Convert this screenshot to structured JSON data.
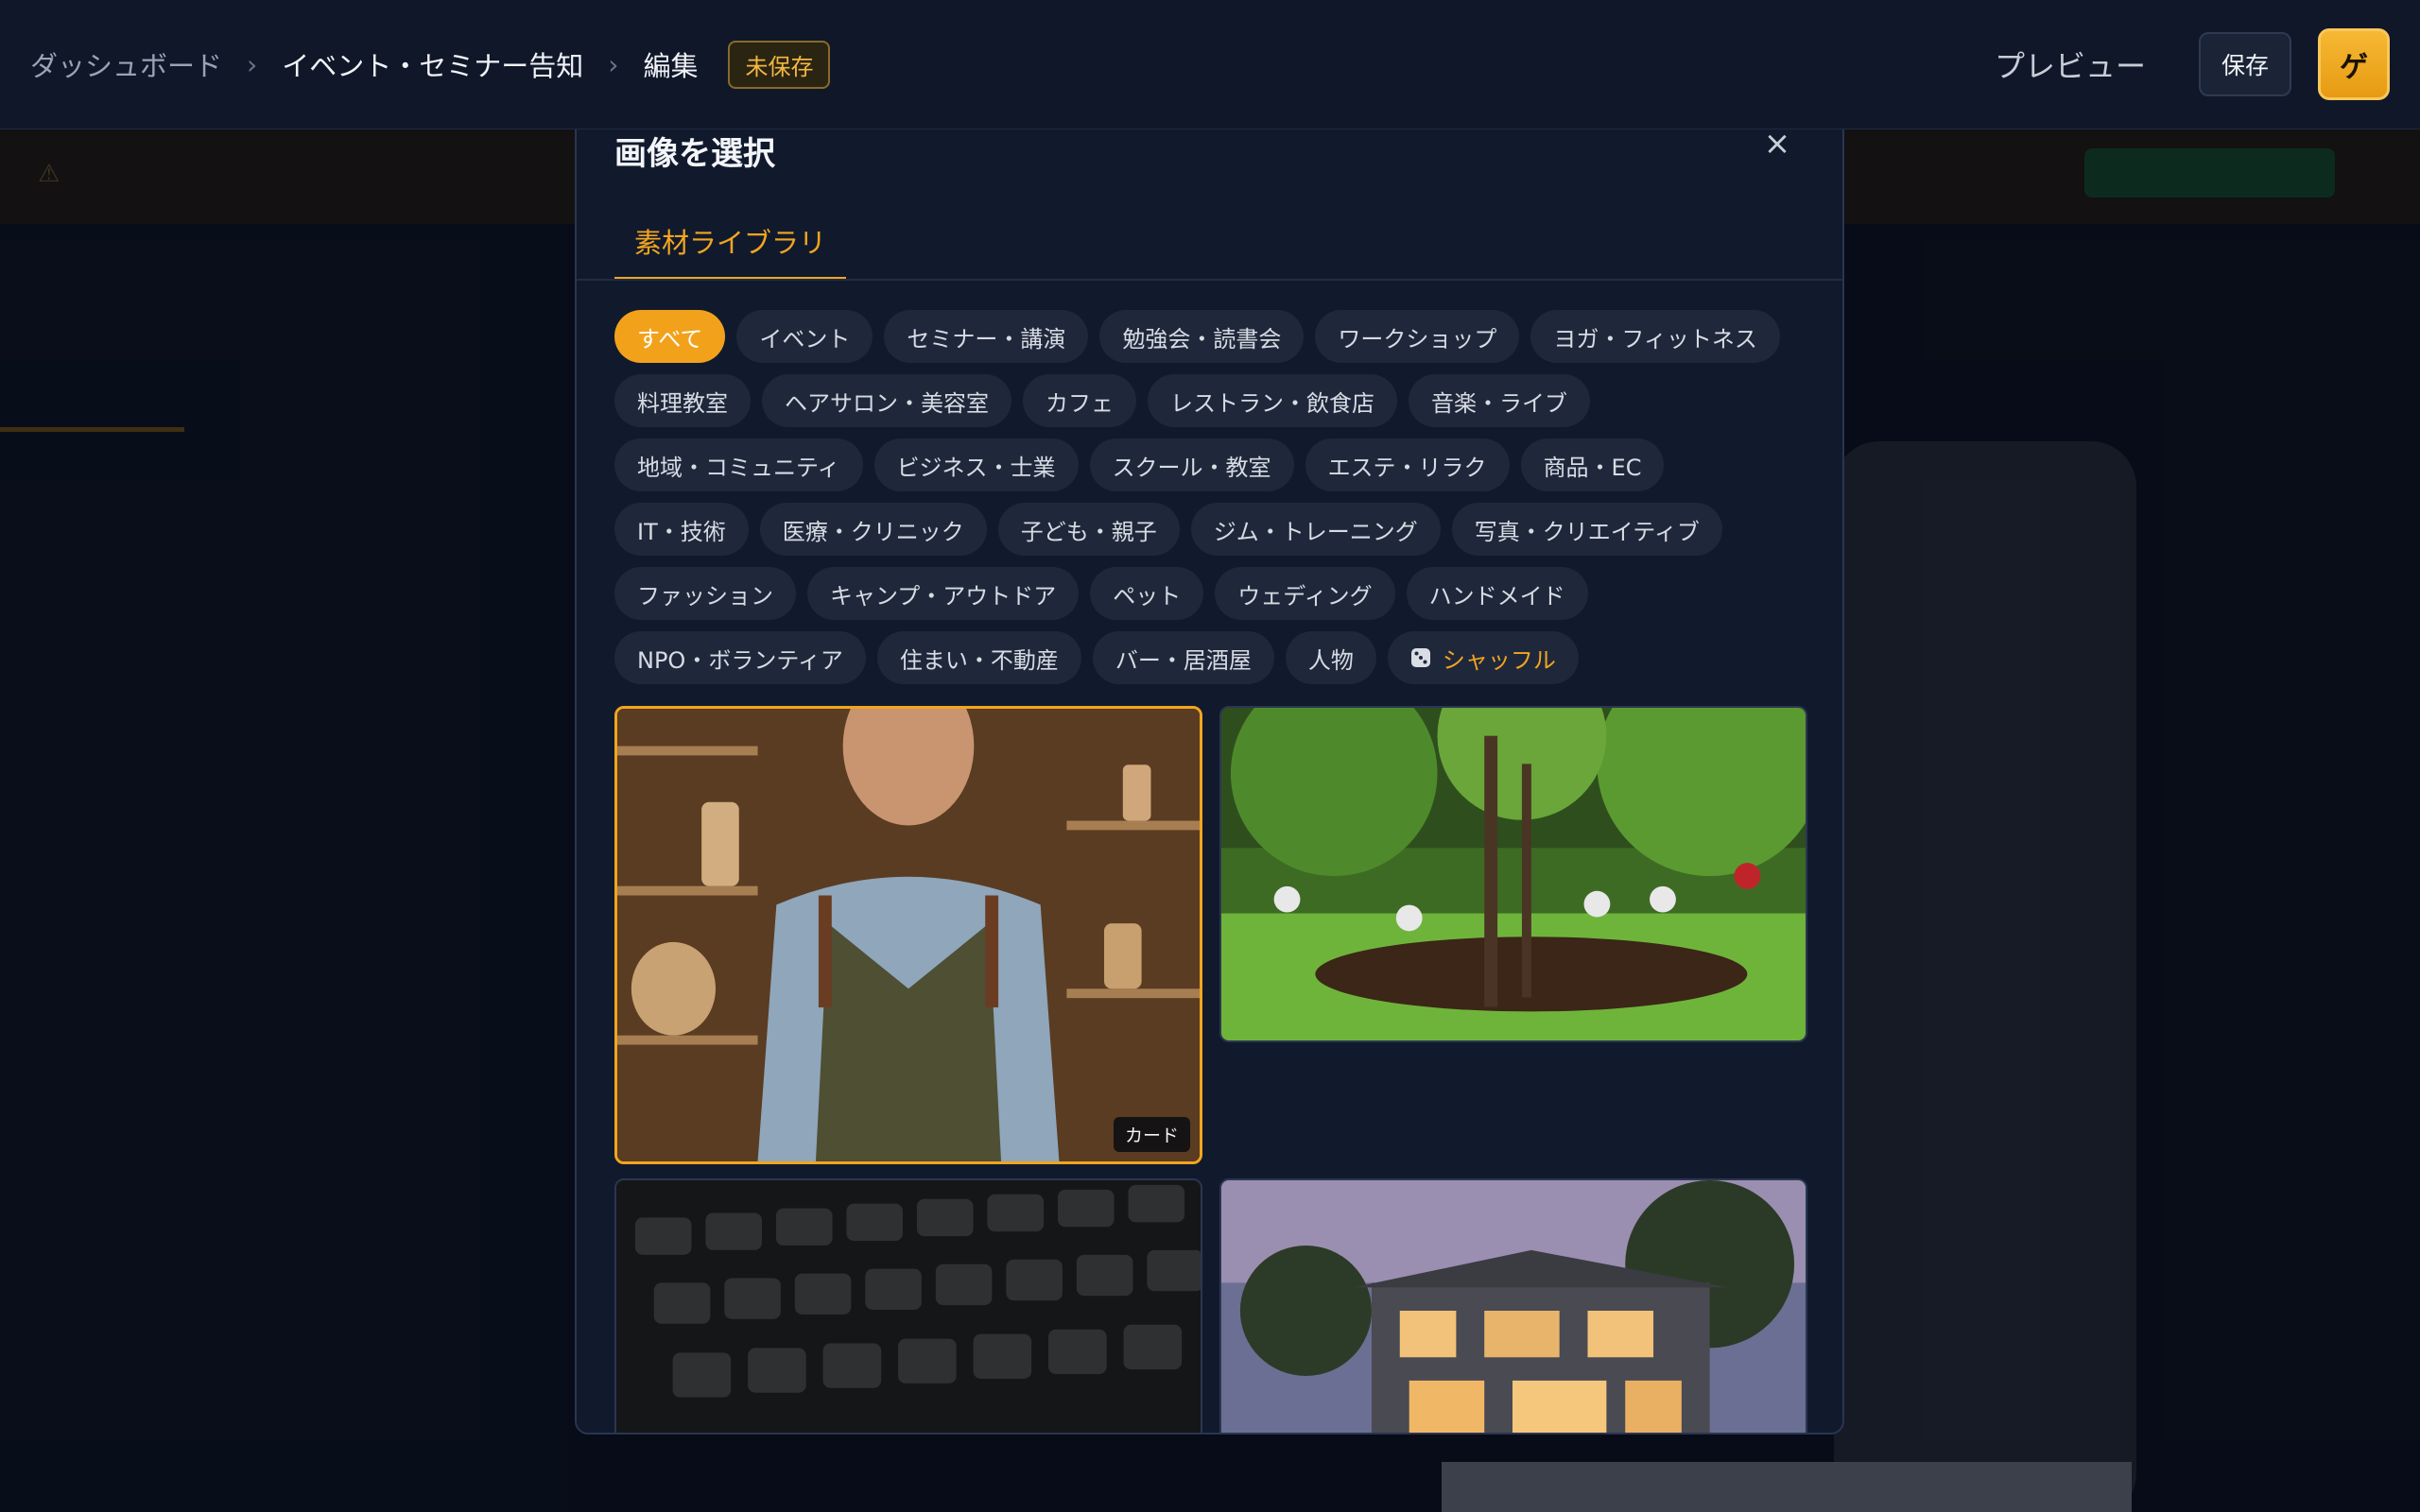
{
  "breadcrumb": {
    "items": [
      "ダッシュボード",
      "イベント・セミナー告知",
      "編集"
    ],
    "separator": "›",
    "unsaved_badge": "未保存"
  },
  "header": {
    "preview_label": "プレビュー",
    "save_label": "保存",
    "publish_label": "ゲ"
  },
  "modal": {
    "title": "画像を選択",
    "close_label": "×",
    "tab_label": "素材ライブラリ",
    "categories_row1": [
      "すべて",
      "イベント",
      "セミナー・講演",
      "勉強会・読書会",
      "ワークショップ",
      "ヨガ・フィットネス"
    ],
    "categories_row2": [
      "料理教室",
      "ヘアサロン・美容室",
      "カフェ",
      "レストラン・飲食店",
      "音楽・ライブ"
    ],
    "categories_row3": [
      "地域・コミュニティ",
      "ビジネス・士業",
      "スクール・教室",
      "エステ・リラク",
      "商品・EC"
    ],
    "categories_row4": [
      "IT・技術",
      "医療・クリニック",
      "子ども・親子",
      "ジム・トレーニング",
      "写真・クリエイティブ"
    ],
    "categories_row5": [
      "ファッション",
      "キャンプ・アウトドア",
      "ペット",
      "ウェディング",
      "ハンドメイド"
    ],
    "categories_row6": [
      "NPO・ボランティア",
      "住まい・不動産",
      "バー・居酒屋",
      "人物"
    ],
    "shuffle_label": "シャッフル",
    "active_category": "すべて",
    "images": [
      {
        "id": "craftsman",
        "badge": "カード",
        "selected": true
      },
      {
        "id": "tree-planting",
        "badge": "",
        "selected": false
      },
      {
        "id": "keyboard",
        "badge": "",
        "selected": false
      },
      {
        "id": "house",
        "badge": "",
        "selected": false
      }
    ]
  },
  "colors": {
    "accent": "#f2a51f",
    "background": "#0d1424",
    "modal": "#111a2d",
    "chip": "#1f283b"
  }
}
